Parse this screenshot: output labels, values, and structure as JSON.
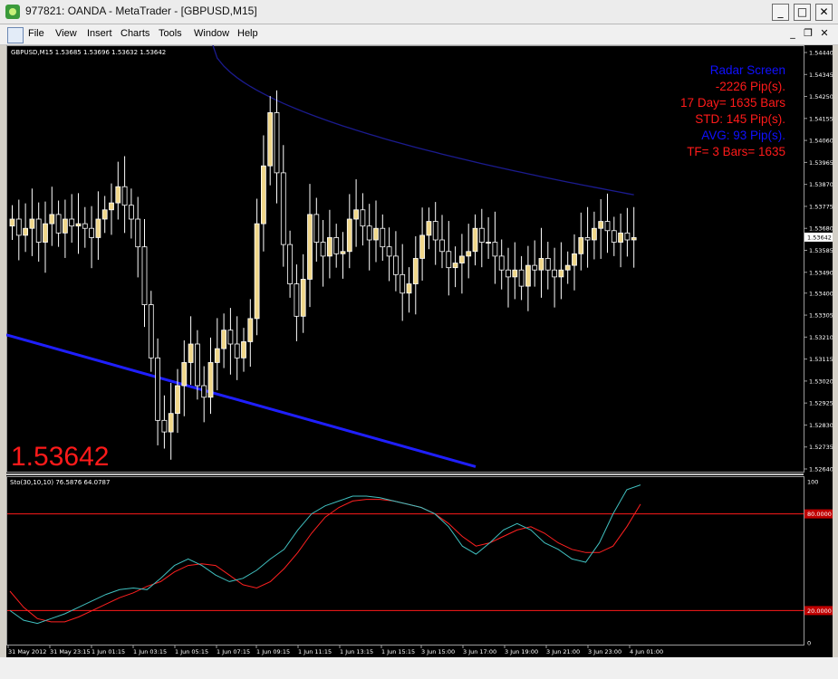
{
  "window": {
    "title": "977821: OANDA - MetaTrader - [GBPUSD,M15]"
  },
  "menu": [
    "File",
    "View",
    "Insert",
    "Charts",
    "Tools",
    "Window",
    "Help"
  ],
  "chart": {
    "header": "GBPUSD,M15  1.53685 1.53696 1.53632 1.53642",
    "big_price": "1.53642",
    "current_price_label": "1.53642",
    "radar_lines": [
      {
        "text": "Radar Screen",
        "color": "#1010ff"
      },
      {
        "text": "-2226 Pip(s).",
        "color": "#ff1a1a"
      },
      {
        "text": "17 Day= 1635 Bars",
        "color": "#ff1a1a"
      },
      {
        "text": "STD: 145 Pip(s).",
        "color": "#ff1a1a"
      },
      {
        "text": "AVG: 93 Pip(s).",
        "color": "#1010ff"
      },
      {
        "text": "TF= 3 Bars= 1635",
        "color": "#ff1a1a"
      }
    ],
    "price_axis": [
      "1.54440",
      "1.54345",
      "1.54250",
      "1.54155",
      "1.54060",
      "1.53965",
      "1.53870",
      "1.53775",
      "1.53680",
      "1.53585",
      "1.53490",
      "1.53400",
      "1.53305",
      "1.53210",
      "1.53115",
      "1.53020",
      "1.52925",
      "1.52830",
      "1.52735",
      "1.52640"
    ],
    "indicator_header": "Sto(30,10,10) 76.5876 64.0787",
    "indicator_axis": [
      "100",
      "80.0000",
      "20.0000",
      "0"
    ],
    "time_axis": [
      "31 May 2012",
      "31 May 23:15",
      "1 Jun 01:15",
      "1 Jun 03:15",
      "1 Jun 05:15",
      "1 Jun 07:15",
      "1 Jun 09:15",
      "1 Jun 11:15",
      "1 Jun 13:15",
      "1 Jun 15:15",
      "3 Jun 15:00",
      "3 Jun 17:00",
      "3 Jun 19:00",
      "3 Jun 21:00",
      "3 Jun 23:00",
      "4 Jun 01:00"
    ],
    "colors": {
      "bull": "#f0d78a",
      "bear": "#000000",
      "wick": "#ffffff",
      "trend": "#1f1fff",
      "ma": "#1b1b8f",
      "sto_main": "#40c0c0",
      "sto_signal": "#ff2020",
      "level": "#ff1a1a"
    }
  },
  "chart_data": {
    "type": "candlestick",
    "symbol": "GBPUSD",
    "timeframe": "M15",
    "ylim": [
      1.5264,
      1.5444
    ],
    "close_series": [
      1.5372,
      1.5365,
      1.5368,
      1.5372,
      1.5362,
      1.537,
      1.5374,
      1.5366,
      1.5372,
      1.5369,
      1.537,
      1.5368,
      1.5364,
      1.5372,
      1.5376,
      1.5379,
      1.5386,
      1.5378,
      1.5372,
      1.536,
      1.5335,
      1.5312,
      1.5285,
      1.528,
      1.5288,
      1.53,
      1.531,
      1.5318,
      1.53,
      1.5295,
      1.531,
      1.5316,
      1.5324,
      1.5318,
      1.5312,
      1.5319,
      1.5329,
      1.537,
      1.5395,
      1.5418,
      1.5392,
      1.5361,
      1.5344,
      1.533,
      1.5346,
      1.5374,
      1.5362,
      1.5356,
      1.5364,
      1.5357,
      1.5358,
      1.5372,
      1.5376,
      1.5369,
      1.5363,
      1.5368,
      1.536,
      1.5356,
      1.5348,
      1.534,
      1.5344,
      1.5355,
      1.5365,
      1.5371,
      1.5363,
      1.5358,
      1.5351,
      1.5353,
      1.5356,
      1.5358,
      1.5368,
      1.5362,
      1.5362,
      1.5356,
      1.535,
      1.5347,
      1.535,
      1.5343,
      1.5352,
      1.535,
      1.5355,
      1.535,
      1.5347,
      1.535,
      1.5352,
      1.5357,
      1.5364,
      1.5363,
      1.5368,
      1.5371,
      1.5367,
      1.5362,
      1.5366,
      1.5363,
      1.5364
    ],
    "stochastic": {
      "main": [
        20,
        14,
        12,
        15,
        18,
        22,
        26,
        30,
        33,
        34,
        33,
        40,
        48,
        52,
        48,
        42,
        38,
        40,
        45,
        52,
        58,
        70,
        80,
        85,
        88,
        91,
        91,
        90,
        88,
        86,
        84,
        80,
        72,
        60,
        55,
        62,
        70,
        74,
        70,
        62,
        58,
        52,
        50,
        62,
        80,
        95,
        98
      ],
      "signal": [
        32,
        22,
        15,
        13,
        13,
        16,
        20,
        24,
        28,
        31,
        35,
        38,
        44,
        48,
        49,
        48,
        42,
        36,
        34,
        38,
        46,
        56,
        68,
        78,
        84,
        88,
        89,
        89,
        88,
        86,
        84,
        80,
        74,
        66,
        60,
        62,
        66,
        70,
        72,
        68,
        62,
        58,
        56,
        56,
        60,
        72,
        86
      ]
    }
  }
}
